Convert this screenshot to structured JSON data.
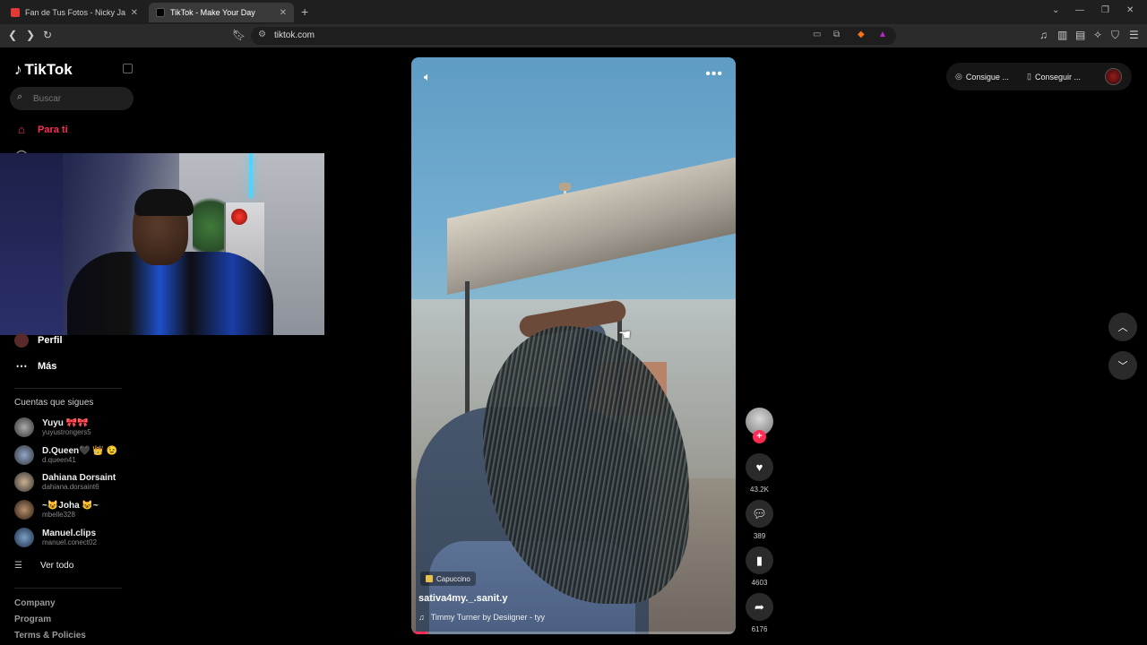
{
  "browser": {
    "tabs": [
      {
        "title": "Fan de Tus Fotos - Nicky Jam x Rome",
        "active": false
      },
      {
        "title": "TikTok - Make Your Day",
        "active": true
      }
    ],
    "url": "tiktok.com"
  },
  "sidebar": {
    "logo": "TikTok",
    "search_placeholder": "Buscar",
    "nav": [
      {
        "label": "Para ti",
        "icon": "home-icon",
        "active": true
      },
      {
        "label": "Perfil",
        "icon": "avatar",
        "active": false
      },
      {
        "label": "Más",
        "icon": "more-dots-icon",
        "active": false
      }
    ],
    "following_title": "Cuentas que sigues",
    "accounts": [
      {
        "name": "Yuyu 🎀🎀",
        "handle": "yuyustrongers5"
      },
      {
        "name": "D.Queen🖤 👑 😉",
        "handle": "d.queen41"
      },
      {
        "name": "Dahiana Dorsaint",
        "handle": "dahiana.dorsaint6"
      },
      {
        "name": "~😺Joha 😺~",
        "handle": "mbelle328"
      },
      {
        "name": "Manuel.clips",
        "handle": "manuel.conect02"
      }
    ],
    "see_all": "Ver todo",
    "footer": [
      "Company",
      "Program",
      "Terms & Policies"
    ]
  },
  "video": {
    "sticker": "Capuccino",
    "username": "sativa4my._.sanit.y",
    "music": "Timmy Turner by Desiigner - tyy",
    "progress": 0.05
  },
  "actions": {
    "likes": "43.2K",
    "comments": "389",
    "saves": "4603",
    "shares": "6176"
  },
  "topright": {
    "coins_label": "Consigue ...",
    "app_label": "Conseguir ..."
  },
  "colors": {
    "accent": "#fe2c55"
  }
}
